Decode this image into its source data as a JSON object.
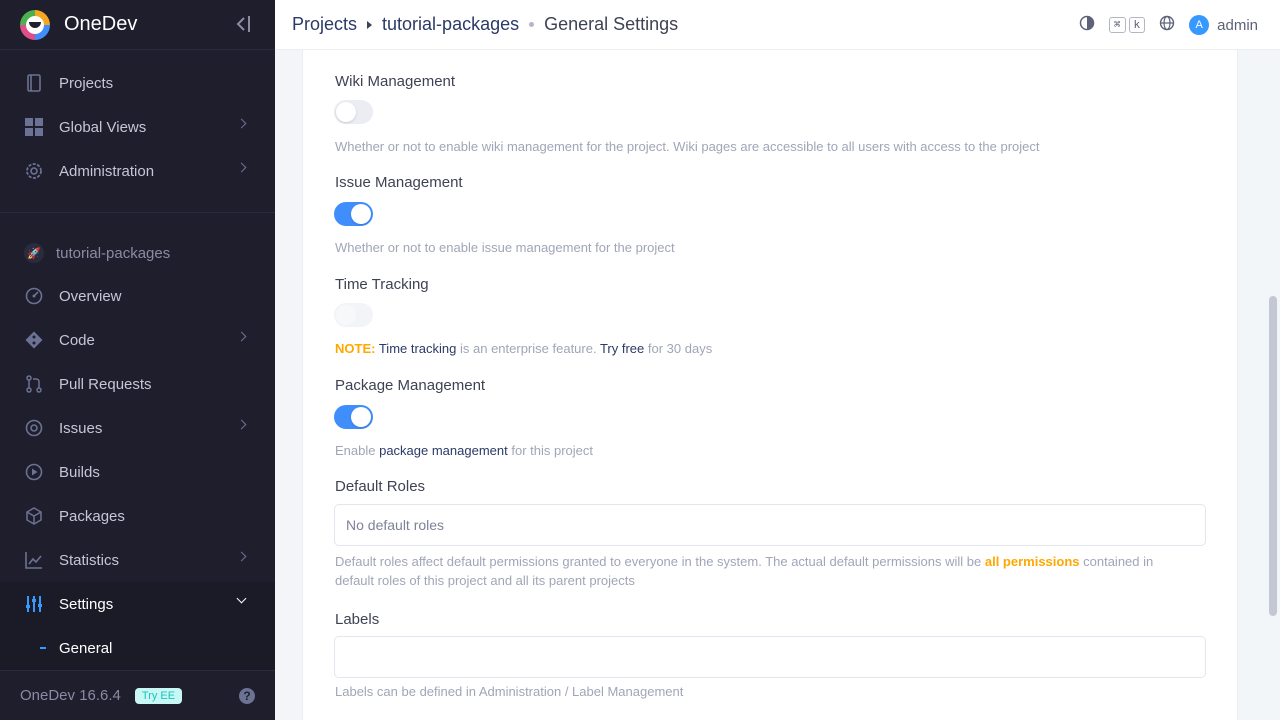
{
  "app": {
    "name": "OneDev",
    "version": "OneDev 16.6.4",
    "try_ee": "Try EE"
  },
  "sidebar": {
    "global": [
      {
        "label": "Projects",
        "icon": "book-icon"
      },
      {
        "label": "Global Views",
        "icon": "grid-icon"
      },
      {
        "label": "Administration",
        "icon": "gear-icon"
      }
    ],
    "project_name": "tutorial-packages",
    "project": [
      {
        "label": "Overview",
        "icon": "dashboard-icon"
      },
      {
        "label": "Code",
        "icon": "git-icon"
      },
      {
        "label": "Pull Requests",
        "icon": "pull-request-icon"
      },
      {
        "label": "Issues",
        "icon": "issue-icon"
      },
      {
        "label": "Builds",
        "icon": "play-icon"
      },
      {
        "label": "Packages",
        "icon": "package-icon"
      },
      {
        "label": "Statistics",
        "icon": "chart-icon"
      },
      {
        "label": "Settings",
        "icon": "sliders-icon"
      }
    ],
    "sub_general": "General"
  },
  "breadcrumb": {
    "root": "Projects",
    "project": "tutorial-packages",
    "page": "General Settings"
  },
  "topbar": {
    "user": "admin",
    "avatar_letter": "A",
    "kbd1": "⌘",
    "kbd2": "k"
  },
  "form": {
    "wiki": {
      "label": "Wiki Management",
      "enabled": false,
      "hint": "Whether or not to enable wiki management for the project. Wiki pages are accessible to all users with access to the project"
    },
    "issue": {
      "label": "Issue Management",
      "enabled": true,
      "hint": "Whether or not to enable issue management for the project"
    },
    "time": {
      "label": "Time Tracking",
      "enabled": false,
      "note": "NOTE:",
      "feature": "Time tracking",
      "mid": " is an enterprise feature. ",
      "try": "Try free",
      "end": " for 30 days"
    },
    "package": {
      "label": "Package Management",
      "enabled": true,
      "pre": "Enable ",
      "link": "package management",
      "post": " for this project"
    },
    "roles": {
      "label": "Default Roles",
      "placeholder": "No default roles",
      "hint_pre": "Default roles affect default permissions granted to everyone in the system. The actual default permissions will be ",
      "hint_link": "all permissions",
      "hint_post": " contained in default roles of this project and all its parent projects"
    },
    "labels": {
      "label": "Labels",
      "value": "",
      "hint": "Labels can be defined in Administration / Label Management"
    }
  }
}
